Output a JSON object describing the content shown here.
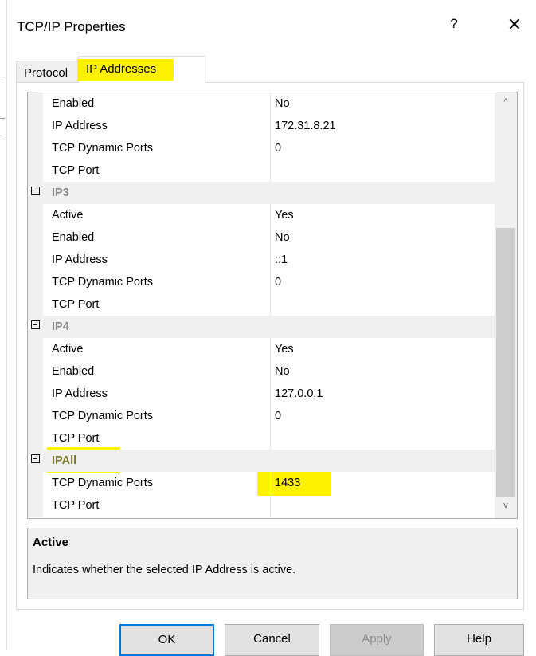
{
  "window": {
    "title": "TCP/IP Properties",
    "help_glyph": "?",
    "close_glyph": "✕"
  },
  "tabs": [
    {
      "label": "Protocol",
      "active": false
    },
    {
      "label": "IP Addresses",
      "active": true
    }
  ],
  "grid": {
    "rows": [
      {
        "kind": "prop",
        "name": "Enabled",
        "value": "No"
      },
      {
        "kind": "prop",
        "name": "IP Address",
        "value": "172.31.8.21"
      },
      {
        "kind": "prop",
        "name": "TCP Dynamic Ports",
        "value": "0"
      },
      {
        "kind": "prop",
        "name": "TCP Port",
        "value": ""
      },
      {
        "kind": "category",
        "name": "IP3"
      },
      {
        "kind": "prop",
        "name": "Active",
        "value": "Yes"
      },
      {
        "kind": "prop",
        "name": "Enabled",
        "value": "No"
      },
      {
        "kind": "prop",
        "name": "IP Address",
        "value": "::1"
      },
      {
        "kind": "prop",
        "name": "TCP Dynamic Ports",
        "value": "0"
      },
      {
        "kind": "prop",
        "name": "TCP Port",
        "value": ""
      },
      {
        "kind": "category",
        "name": "IP4"
      },
      {
        "kind": "prop",
        "name": "Active",
        "value": "Yes"
      },
      {
        "kind": "prop",
        "name": "Enabled",
        "value": "No"
      },
      {
        "kind": "prop",
        "name": "IP Address",
        "value": "127.0.0.1"
      },
      {
        "kind": "prop",
        "name": "TCP Dynamic Ports",
        "value": "0"
      },
      {
        "kind": "prop",
        "name": "TCP Port",
        "value": ""
      },
      {
        "kind": "category",
        "name": "IPAll"
      },
      {
        "kind": "prop",
        "name": "TCP Dynamic Ports",
        "value": "1433"
      },
      {
        "kind": "prop",
        "name": "TCP Port",
        "value": ""
      }
    ],
    "scroll_up_glyph": "^",
    "scroll_down_glyph": "v"
  },
  "description": {
    "title": "Active",
    "text": "Indicates whether the selected IP Address is active."
  },
  "buttons": {
    "ok": "OK",
    "cancel": "Cancel",
    "apply": "Apply",
    "help": "Help"
  },
  "colors": {
    "highlight": "#fff200",
    "ok_border": "#0078d7",
    "category_bg": "#f0f0f0"
  }
}
